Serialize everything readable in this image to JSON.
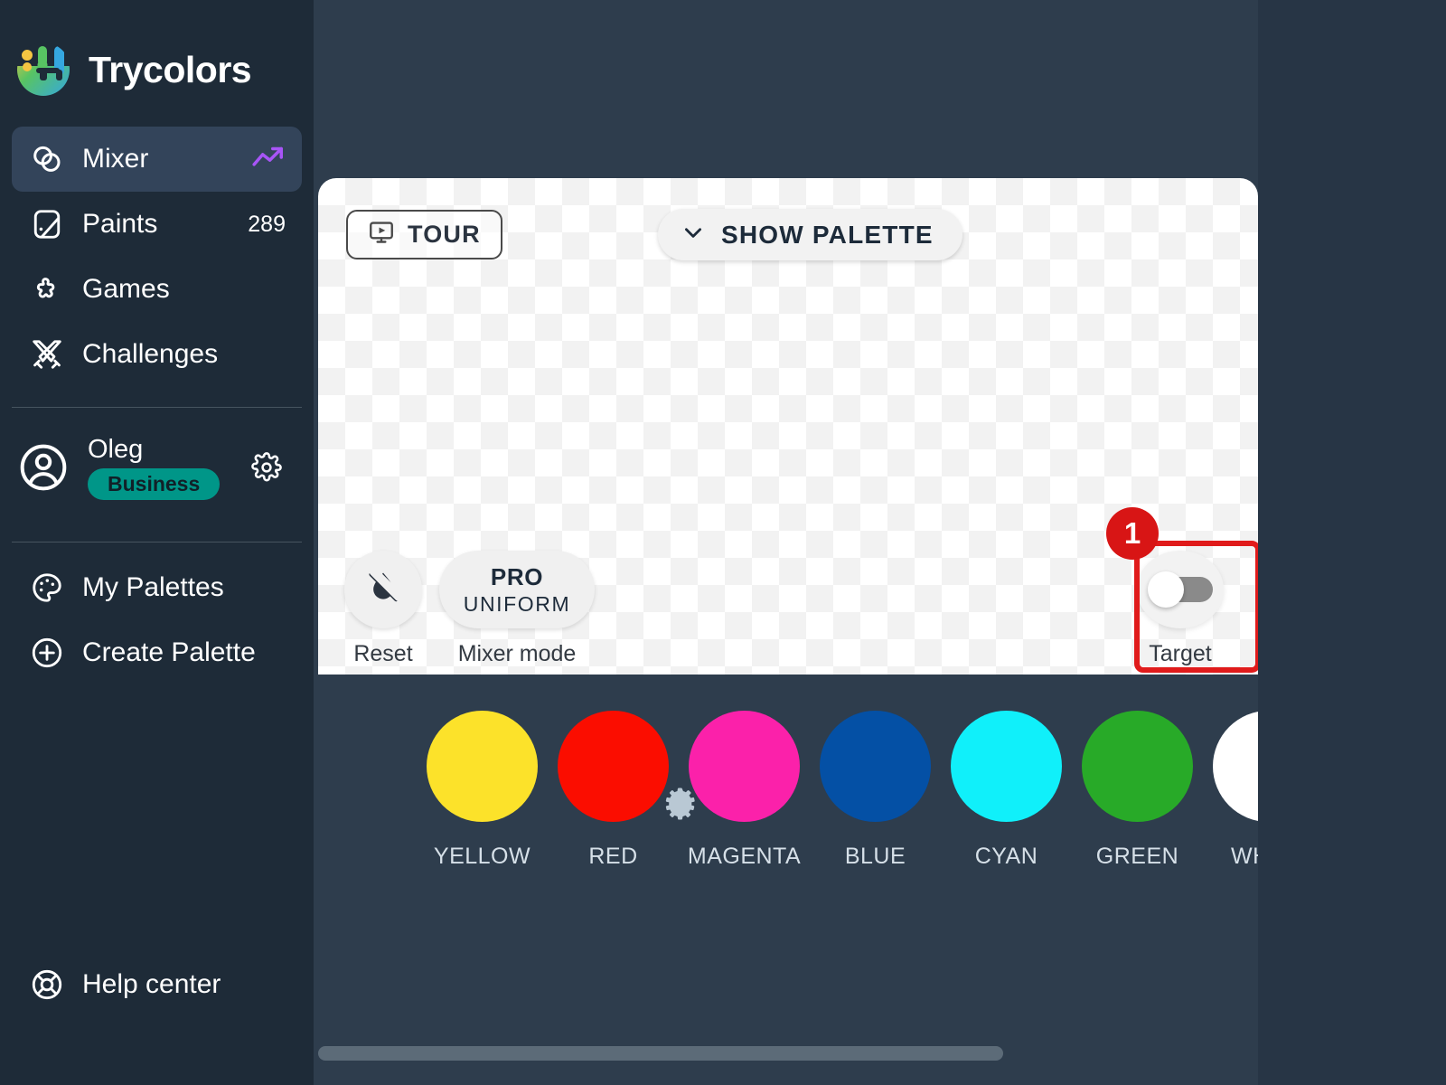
{
  "app": {
    "brand_name": "Trycolors",
    "bg_sidebar": "#1e2b38",
    "bg_main": "#2e3d4d",
    "accent_purple": "#a855f7",
    "accent_teal": "#009688",
    "annotation_red": "#d81515"
  },
  "sidebar": {
    "items": [
      {
        "label": "Mixer",
        "icon": "mixer-circles-icon",
        "active": true,
        "trend_icon": "trending-up-icon"
      },
      {
        "label": "Paints",
        "icon": "paints-icon",
        "count": "289"
      },
      {
        "label": "Games",
        "icon": "puzzle-icon"
      },
      {
        "label": "Challenges",
        "icon": "crossed-swords-icon"
      }
    ],
    "profile": {
      "name": "Oleg",
      "plan_badge": "Business",
      "avatar_icon": "user-circle-icon",
      "settings_icon": "gear-icon"
    },
    "bottom_items": [
      {
        "label": "My Palettes",
        "icon": "palette-icon"
      },
      {
        "label": "Create Palette",
        "icon": "plus-circle-icon"
      }
    ],
    "help": {
      "label": "Help center",
      "icon": "lifebuoy-icon"
    }
  },
  "mixer": {
    "tour_button": {
      "label": "TOUR",
      "icon": "monitor-play-icon"
    },
    "show_palette_button": {
      "label": "SHOW PALETTE",
      "icon": "chevron-down-icon"
    },
    "reset": {
      "caption": "Reset",
      "icon": "drop-slash-icon"
    },
    "mixer_mode": {
      "caption": "Mixer mode",
      "value_top": "PRO",
      "value_bottom": "UNIFORM"
    },
    "target": {
      "caption": "Target",
      "state": "off"
    }
  },
  "annotation": {
    "step_number": "1"
  },
  "palette": {
    "settings_icon": "gear-icon",
    "swatches": [
      {
        "label": "YELLOW",
        "color": "#FCE22A"
      },
      {
        "label": "RED",
        "color": "#FB0D00"
      },
      {
        "label": "MAGENTA",
        "color": "#FB21AA"
      },
      {
        "label": "BLUE",
        "color": "#0450A5"
      },
      {
        "label": "CYAN",
        "color": "#10F0FA"
      },
      {
        "label": "GREEN",
        "color": "#28AA28"
      },
      {
        "label": "WHITE",
        "color": "#FFFFFF"
      }
    ]
  }
}
